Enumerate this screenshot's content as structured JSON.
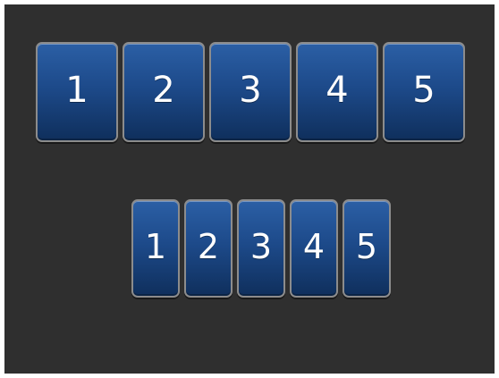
{
  "panel": {
    "background": "#2f2f2f",
    "frame_color": "#ffffff"
  },
  "large_row": {
    "items": [
      {
        "label": "1"
      },
      {
        "label": "2"
      },
      {
        "label": "3"
      },
      {
        "label": "4"
      },
      {
        "label": "5"
      }
    ]
  },
  "small_row": {
    "items": [
      {
        "label": "1"
      },
      {
        "label": "2"
      },
      {
        "label": "3"
      },
      {
        "label": "4"
      },
      {
        "label": "5"
      }
    ]
  },
  "colors": {
    "button_top": "#2b5fa5",
    "button_mid": "#1d4a8a",
    "button_bottom": "#0f2f5c",
    "button_border": "#8c8c8c",
    "text": "#ffffff"
  }
}
